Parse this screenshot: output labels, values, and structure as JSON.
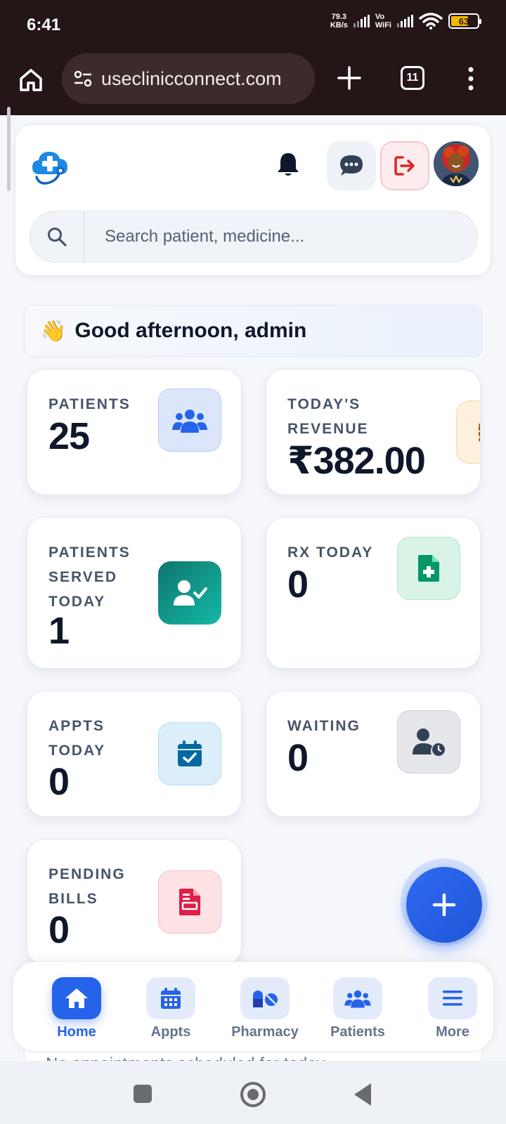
{
  "status_bar": {
    "time": "6:41",
    "speed_value": "79.3",
    "speed_unit": "KB/s",
    "vo": "Vo",
    "wifi": "WiFi",
    "battery": "63"
  },
  "browser": {
    "url": "useclinicconnect.com",
    "tab_count": "11"
  },
  "header": {
    "search_placeholder": "Search patient, medicine...",
    "icons": [
      "bell-icon",
      "chat-icon",
      "logout-icon",
      "avatar"
    ]
  },
  "greeting": {
    "emoji": "👋",
    "text": "Good afternoon, admin"
  },
  "stats": [
    {
      "label": "PATIENTS",
      "value": "25",
      "icon": "users-icon",
      "color": "#2563eb"
    },
    {
      "label": "TODAY'S REVENUE",
      "value": "₹382.00",
      "icon": "coins-icon",
      "color": "#d97706"
    },
    {
      "label": "PATIENTS SERVED TODAY",
      "value": "1",
      "icon": "user-check-icon",
      "color": "#0d9488"
    },
    {
      "label": "RX TODAY",
      "value": "0",
      "icon": "file-medical-icon",
      "color": "#059669"
    },
    {
      "label": "APPTS TODAY",
      "value": "0",
      "icon": "calendar-check-icon",
      "color": "#0284c7"
    },
    {
      "label": "WAITING",
      "value": "0",
      "icon": "user-clock-icon",
      "color": "#334155"
    },
    {
      "label": "PENDING BILLS",
      "value": "0",
      "icon": "invoice-icon",
      "color": "#e11d48"
    }
  ],
  "empty_message": "No appointments scheduled for today",
  "bottom_nav": [
    {
      "label": "Home",
      "icon": "home-icon",
      "active": true
    },
    {
      "label": "Appts",
      "icon": "calendar-icon"
    },
    {
      "label": "Pharmacy",
      "icon": "pills-icon"
    },
    {
      "label": "Patients",
      "icon": "users-icon"
    },
    {
      "label": "More",
      "icon": "menu-icon"
    }
  ]
}
